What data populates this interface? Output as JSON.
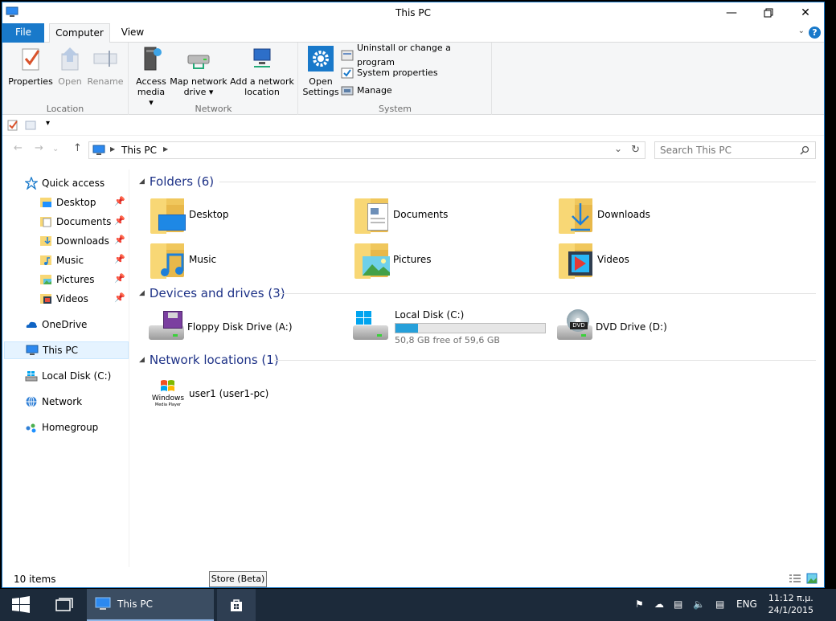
{
  "window": {
    "title": "This PC"
  },
  "tabs": {
    "file": "File",
    "computer": "Computer",
    "view": "View"
  },
  "ribbon": {
    "location": {
      "label": "Location",
      "properties": "Properties",
      "open": "Open",
      "rename": "Rename"
    },
    "network": {
      "label": "Network",
      "access_media_1": "Access",
      "access_media_2": "media ▾",
      "map_drive_1": "Map network",
      "map_drive_2": "drive ▾",
      "add_location_1": "Add a network",
      "add_location_2": "location"
    },
    "system": {
      "label": "System",
      "open_settings_1": "Open",
      "open_settings_2": "Settings",
      "uninstall": "Uninstall or change a program",
      "system_properties": "System properties",
      "manage": "Manage"
    }
  },
  "address": {
    "crumb": "This PC"
  },
  "search": {
    "placeholder": "Search This PC"
  },
  "sidebar": {
    "quick_access": "Quick access",
    "items": [
      "Desktop",
      "Documents",
      "Downloads",
      "Music",
      "Pictures",
      "Videos"
    ],
    "onedrive": "OneDrive",
    "this_pc": "This PC",
    "local_disk": "Local Disk (C:)",
    "network": "Network",
    "homegroup": "Homegroup"
  },
  "content": {
    "folders_header": "Folders (6)",
    "folders": [
      "Desktop",
      "Documents",
      "Downloads",
      "Music",
      "Pictures",
      "Videos"
    ],
    "devices_header": "Devices and drives (3)",
    "floppy": "Floppy Disk Drive (A:)",
    "local_disk": "Local Disk (C:)",
    "local_disk_free": "50,8 GB free of 59,6 GB",
    "local_disk_used_fraction": 0.148,
    "dvd": "DVD Drive (D:)",
    "network_header": "Network locations (1)",
    "network_item": "user1 (user1-pc)",
    "wmp_1": "Windows",
    "wmp_2": "Media Player"
  },
  "status": {
    "count": "10 items"
  },
  "tooltip": "Store (Beta)",
  "taskbar": {
    "app": "This PC",
    "lang": "ENG",
    "time": "11:12 π.μ.",
    "date": "24/1/2015"
  },
  "colors": {
    "accent": "#1979ca",
    "taskbar": "#1c2a3a",
    "folder": "#f8d775"
  }
}
